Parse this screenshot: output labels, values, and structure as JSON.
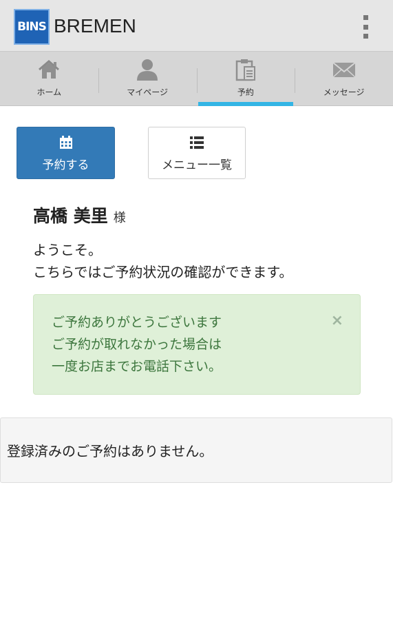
{
  "app": {
    "logo_text": "BINS",
    "name": "BREMEN",
    "overflow_icon": "overflow-menu-icon"
  },
  "tabs": [
    {
      "label": "ホーム",
      "icon": "home-icon",
      "active": false
    },
    {
      "label": "マイページ",
      "icon": "person-icon",
      "active": false
    },
    {
      "label": "予約",
      "icon": "clipboard-icon",
      "active": true
    },
    {
      "label": "メッセージ",
      "icon": "mail-icon",
      "active": false
    }
  ],
  "actions": {
    "reserve_label": "予約する",
    "reserve_icon": "calendar-icon",
    "menu_label": "メニュー一覧",
    "menu_icon": "list-icon"
  },
  "user": {
    "name": "高橋 美里",
    "honorific": "様"
  },
  "welcome": {
    "line1": "ようこそ。",
    "line2": "こちらではご予約状況の確認ができます。"
  },
  "alert": {
    "line1": "ご予約ありがとうございます",
    "line2": "ご予約が取れなかった場合は",
    "line3": "一度お店までお電話下さい。",
    "close": "×"
  },
  "reservations": {
    "empty_message": "登録済みのご予約はありません。"
  },
  "colors": {
    "appbar": "#e6e6e6",
    "tabbar": "#d6d6d6",
    "tab_indicator": "#33b5e5",
    "primary_button": "#337ab7",
    "alert_bg": "#dff0d8",
    "alert_text": "#3c763d",
    "logo_bg": "#1f63b5"
  }
}
